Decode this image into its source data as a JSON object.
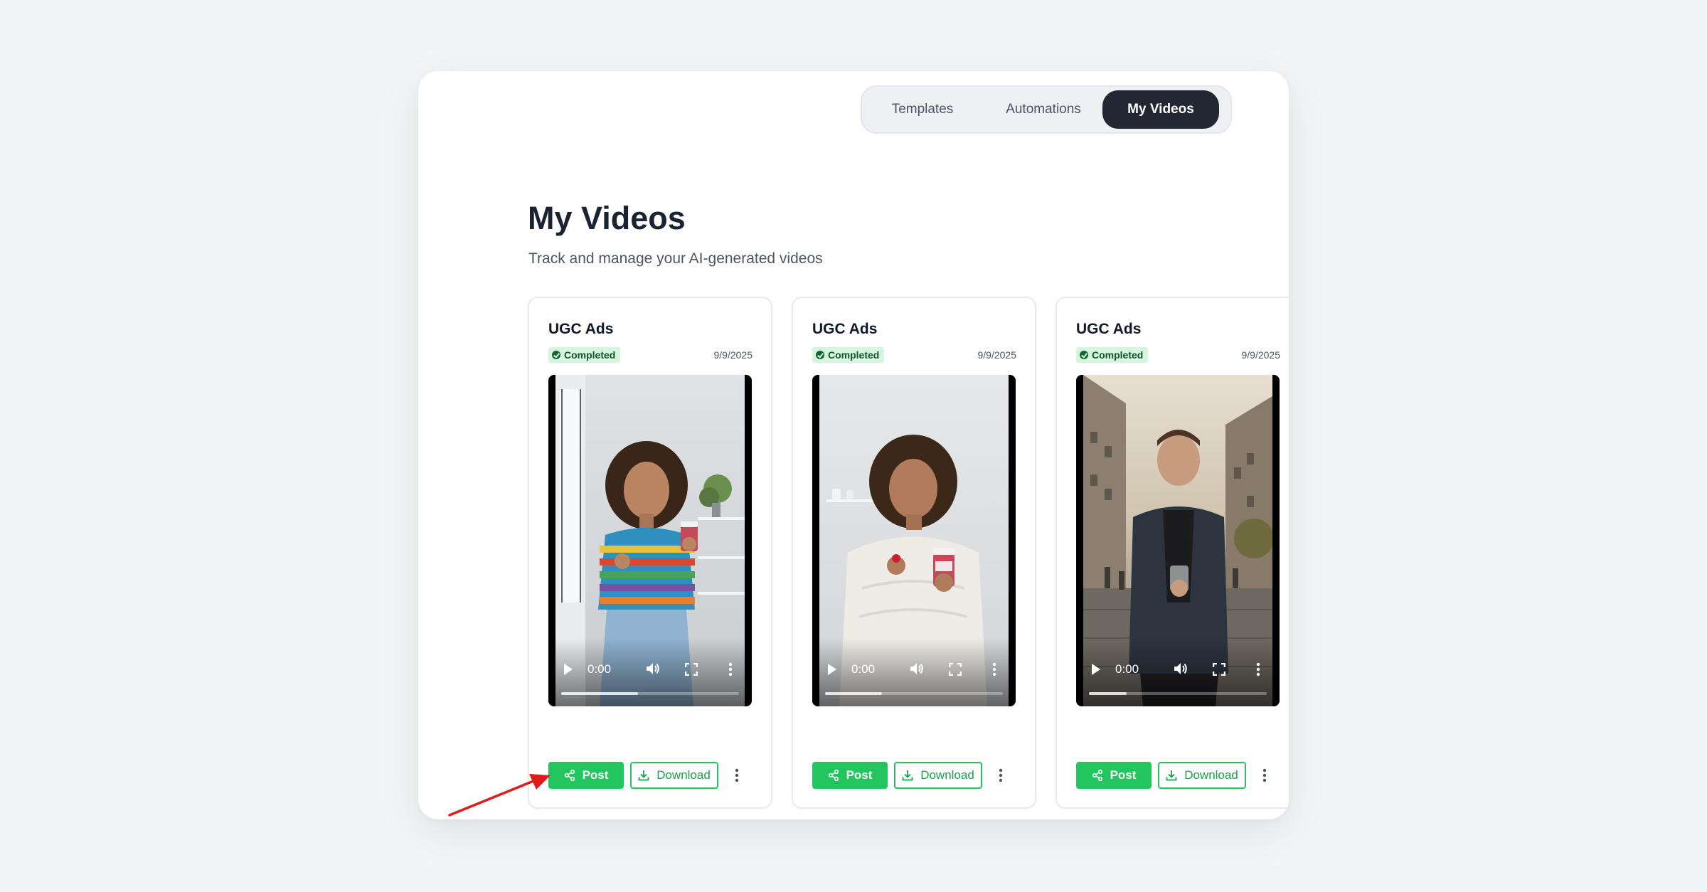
{
  "nav": {
    "tabs": [
      {
        "label": "Templates",
        "active": false
      },
      {
        "label": "Automations",
        "active": false
      },
      {
        "label": "My Videos",
        "active": true
      }
    ]
  },
  "page": {
    "title": "My Videos",
    "subtitle": "Track and manage your AI-generated videos"
  },
  "cards": [
    {
      "title": "UGC Ads",
      "status": "Completed",
      "date": "9/9/2025",
      "video": {
        "time": "0:00",
        "progress_percent": 43
      },
      "post_label": "Post",
      "download_label": "Download"
    },
    {
      "title": "UGC Ads",
      "status": "Completed",
      "date": "9/9/2025",
      "video": {
        "time": "0:00",
        "progress_percent": 32
      },
      "post_label": "Post",
      "download_label": "Download"
    },
    {
      "title": "UGC Ads",
      "status": "Completed",
      "date": "9/9/2025",
      "video": {
        "time": "0:00",
        "progress_percent": 21
      },
      "post_label": "Post",
      "download_label": "Download"
    }
  ],
  "colors": {
    "accent_green": "#22c55e",
    "active_tab": "#232733",
    "badge_bg": "#d5f5df",
    "annotation_arrow": "#e01b1b"
  }
}
